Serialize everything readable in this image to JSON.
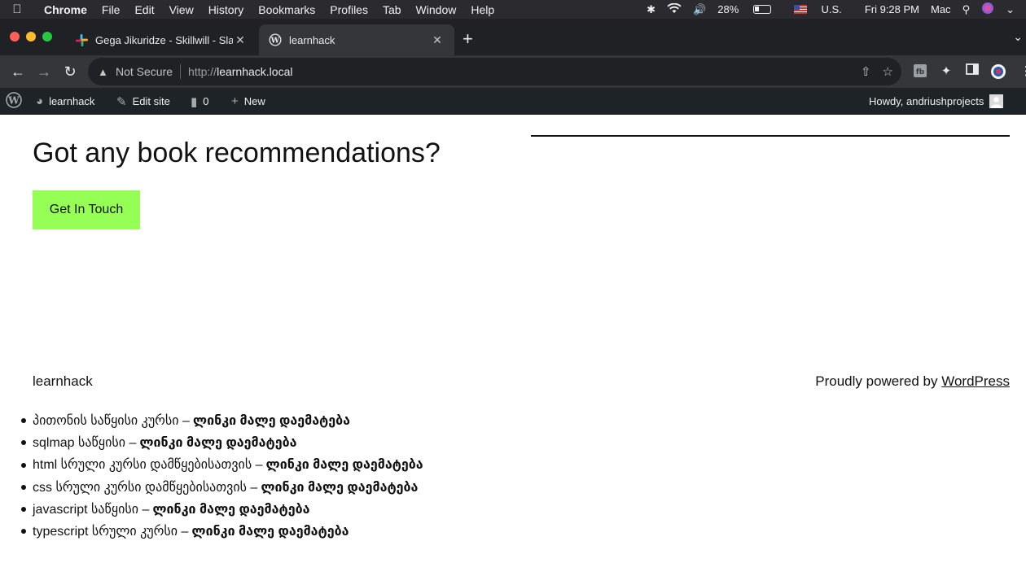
{
  "menubar": {
    "app": "Chrome",
    "items": [
      "File",
      "Edit",
      "View",
      "History",
      "Bookmarks",
      "Profiles",
      "Tab",
      "Window",
      "Help"
    ],
    "battery": "28%",
    "input_source": "U.S.",
    "clock": "Fri 9:28 PM",
    "user": "Mac"
  },
  "tabs": [
    {
      "title": "Gega Jikuridze - Skillwill - Slac",
      "icon": "slack-icon",
      "close": "✕"
    },
    {
      "title": "learnhack",
      "icon": "wordpress-icon",
      "close": "✕"
    }
  ],
  "toolbar": {
    "security_label": "Not Secure",
    "url_scheme": "http://",
    "url_host": "learnhack.local"
  },
  "adminbar": {
    "site_name": "learnhack",
    "edit_site": "Edit site",
    "comments_count": "0",
    "new_label": "New",
    "greeting": "Howdy, andriushprojects"
  },
  "page": {
    "headline": "Got any book recommendations?",
    "cta_label": "Get In Touch",
    "footer_site_title": "learnhack",
    "powered_prefix": "Proudly powered by ",
    "powered_link": "WordPress",
    "courses": [
      {
        "name": "პითონის საწყისი კურსი –",
        "link": "ლინკი მალე დაემატება"
      },
      {
        "name": "sqlmap საწყისი –",
        "link": "ლინკი მალე დაემატება"
      },
      {
        "name": "html სრული კურსი დამწყებისათვის –",
        "link": "ლინკი მალე დაემატება"
      },
      {
        "name": "css სრული კურსი დამწყებისათვის –",
        "link": "ლინკი მალე დაემატება"
      },
      {
        "name": "javascript საწყისი –",
        "link": "ლინკი მალე დაემატება"
      },
      {
        "name": "typescript სრული კურსი –",
        "link": "ლინკი მალე დაემატება"
      }
    ]
  },
  "colors": {
    "cta_background": "#96ff55",
    "adminbar_background": "#1d2327",
    "tabstrip_background": "#202124"
  }
}
